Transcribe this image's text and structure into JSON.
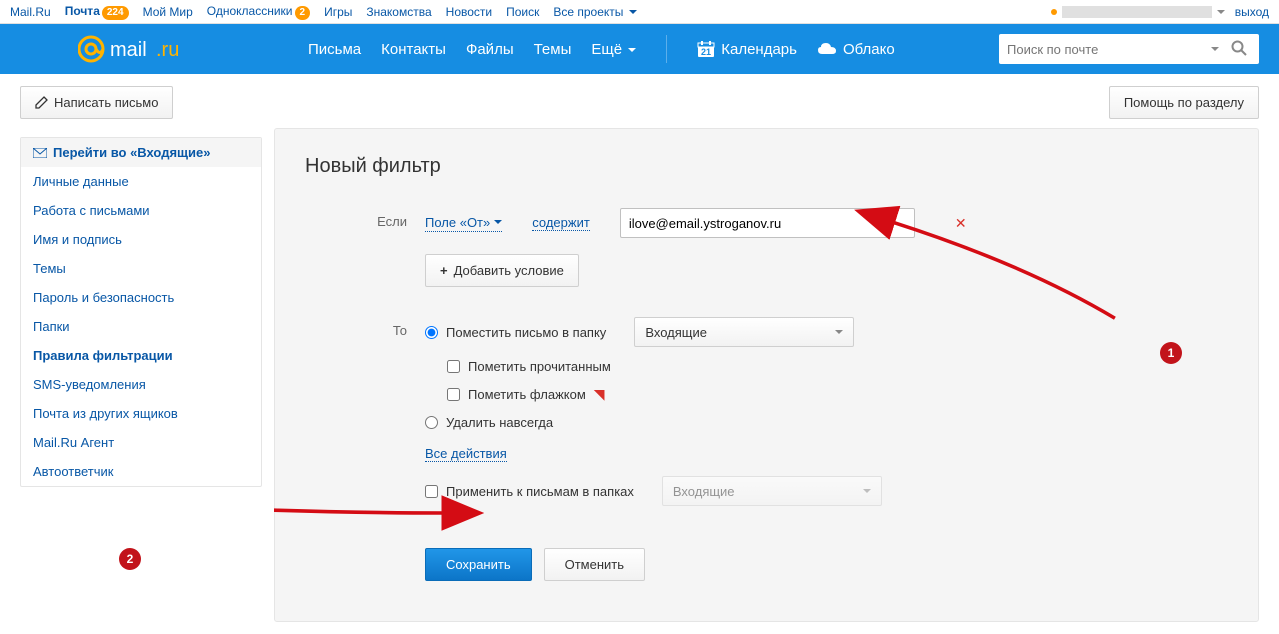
{
  "topbar": {
    "items": [
      {
        "label": "Mail.Ru"
      },
      {
        "label": "Почта",
        "badge": "224",
        "active": true
      },
      {
        "label": "Мой Мир"
      },
      {
        "label": "Одноклассники",
        "badge": "2"
      },
      {
        "label": "Игры"
      },
      {
        "label": "Знакомства"
      },
      {
        "label": "Новости"
      },
      {
        "label": "Поиск"
      },
      {
        "label": "Все проекты",
        "caret": true
      }
    ],
    "logout": "выход"
  },
  "header": {
    "nav": [
      "Письма",
      "Контакты",
      "Файлы",
      "Темы",
      "Ещё"
    ],
    "calendar_day": "21",
    "calendar": "Календарь",
    "cloud": "Облако",
    "search_placeholder": "Поиск по почте"
  },
  "compose_label": "Написать письмо",
  "help_label": "Помощь по разделу",
  "sidebar": {
    "header": "Перейти во «Входящие»",
    "items": [
      "Личные данные",
      "Работа с письмами",
      "Имя и подпись",
      "Темы",
      "Пароль и безопасность",
      "Папки",
      "Правила фильтрации",
      "SMS-уведомления",
      "Почта из других ящиков",
      "Mail.Ru Агент",
      "Автоответчик"
    ],
    "active_index": 6
  },
  "filter": {
    "title": "Новый фильтр",
    "if_label": "Если",
    "field_from": "Поле «От»",
    "contains": "содержит",
    "email_value": "ilove@email.ystroganov.ru",
    "add_condition": "Добавить условие",
    "then_label": "То",
    "move_to_folder": "Поместить письмо в папку",
    "folder_selected": "Входящие",
    "mark_read": "Пометить прочитанным",
    "mark_flag": "Пометить флажком",
    "delete_forever": "Удалить навсегда",
    "all_actions": "Все действия",
    "apply_to_folders": "Применить к письмам в папках",
    "apply_folder_selected": "Входящие",
    "save": "Сохранить",
    "cancel": "Отменить"
  },
  "annotations": {
    "a1": "1",
    "a2": "2"
  }
}
